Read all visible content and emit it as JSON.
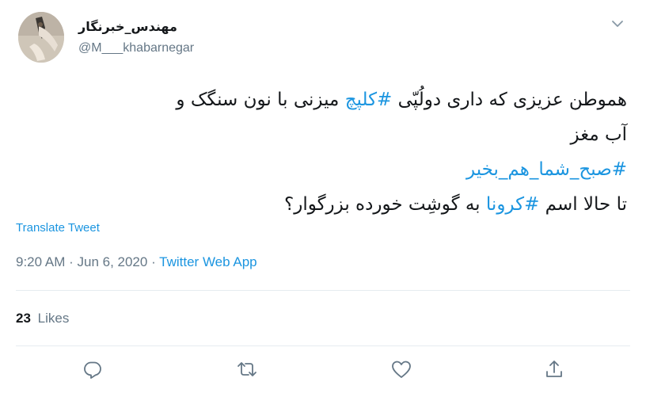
{
  "author": {
    "display_name": "مهندس_خبرنگار",
    "handle": "@M___khabarnegar"
  },
  "tweet": {
    "lines": [
      [
        {
          "text": "هموطن عزیزی که داری دولُپّی ",
          "hashtag": false
        },
        {
          "text": "#کلپچ",
          "hashtag": true
        },
        {
          "text": " میزنی با نون سنگک و",
          "hashtag": false
        }
      ],
      [
        {
          "text": "آب مغز",
          "hashtag": false
        }
      ],
      [
        {
          "text": "#صبح_شما_هم_بخیر",
          "hashtag": true
        }
      ],
      [
        {
          "text": "تا حالا اسم ",
          "hashtag": false
        },
        {
          "text": "#کرونا",
          "hashtag": true
        },
        {
          "text": " به گوشِت خورده بزرگوار؟",
          "hashtag": false
        }
      ]
    ]
  },
  "translate_label": "Translate Tweet",
  "meta": {
    "time": "9:20 AM",
    "separator1": " · ",
    "date": "Jun 6, 2020",
    "separator2": " · ",
    "source": "Twitter Web App"
  },
  "stats": {
    "likes_count": "23",
    "likes_label": "Likes"
  },
  "actions": [
    {
      "name": "reply",
      "icon": "reply-icon"
    },
    {
      "name": "retweet",
      "icon": "retweet-icon"
    },
    {
      "name": "like",
      "icon": "heart-icon"
    },
    {
      "name": "share",
      "icon": "share-icon"
    }
  ],
  "colors": {
    "link": "#1b95e0",
    "secondary_text": "#657786",
    "primary_text": "#14171a",
    "divider": "#e6ecf0"
  }
}
